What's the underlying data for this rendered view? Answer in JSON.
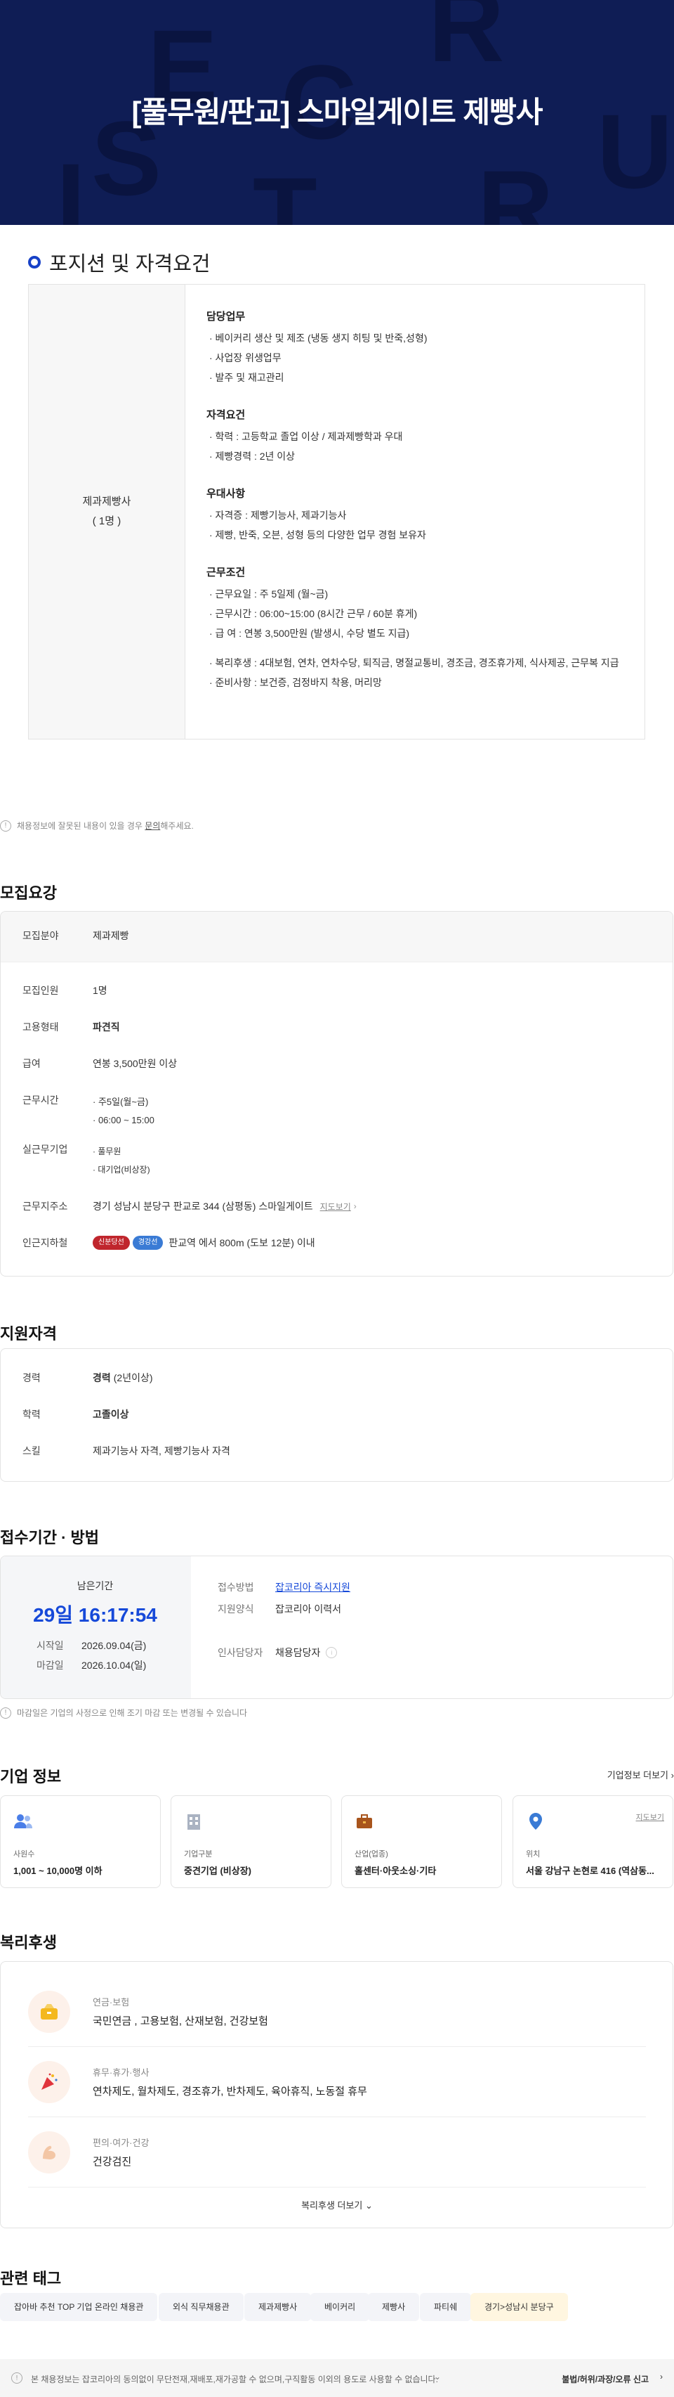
{
  "hero": {
    "title": "[풀무원/판교] 스마일게이트 제빵사",
    "letters": [
      "E",
      "R",
      "C",
      "S",
      "U",
      "I",
      "R",
      "T"
    ]
  },
  "position": {
    "heading": "포지션 및 자격요건",
    "job_name": "제과제빵사",
    "headcount": "( 1명 )",
    "groups": [
      {
        "title": "담당업무",
        "items": [
          "· 베이커리 생산 및 제조 (냉동 생지 히팅 및 반죽,성형)",
          "· 사업장 위생업무",
          "· 발주 및 재고관리"
        ]
      },
      {
        "title": "자격요건",
        "items": [
          "· 학력 : 고등학교 졸업 이상 / 제과제빵학과 우대",
          "· 제빵경력 : 2년 이상"
        ]
      },
      {
        "title": "우대사항",
        "items": [
          "· 자격증 : 제빵기능사, 제과기능사",
          "· 제빵, 반죽, 오븐, 성형 등의 다양한 업무 경험 보유자"
        ]
      },
      {
        "title": "근무조건",
        "items": [
          "· 근무요일 : 주 5일제 (월~금)",
          "· 근무시간 : 06:00~15:00 (8시간 근무 / 60분 휴게)",
          "· 급      여 : 연봉 3,500만원 (발생시, 수당 별도 지급)",
          "",
          "· 복리후생 : 4대보험, 연차, 연차수당, 퇴직금, 명절교통비, 경조금, 경조휴가제, 식사제공, 근무복 지급",
          "· 준비사항 : 보건증, 검정바지 착용, 머리망"
        ]
      }
    ]
  },
  "notice": {
    "text": "채용정보에 잘못된 내용이 있을 경우",
    "link": "문의",
    "tail": "해주세요."
  },
  "recruit": {
    "heading": "모집요강",
    "field_label": "모집분야",
    "field_value": "제과제빵",
    "headcount_label": "모집인원",
    "headcount_value": "1명",
    "type_label": "고용형태",
    "type_value": "파견직",
    "salary_label": "급여",
    "salary_value": "연봉 3,500만원 이상",
    "hours_label": "근무시간",
    "hours_values": [
      "주5일(월~금)",
      "06:00 ~ 15:00"
    ],
    "company_label": "실근무기업",
    "company_values": [
      "풀무원",
      "대기업(비상장)"
    ],
    "address_label": "근무지주소",
    "address_value": "경기 성남시 분당구 판교로 344 (삼평동) 스마일게이트",
    "address_link": "지도보기",
    "subway_label": "인근지하철",
    "subway_lines": [
      "신분당선",
      "경강선"
    ],
    "subway_value": "판교역 에서 800m (도보 12분) 이내"
  },
  "qualify": {
    "heading": "지원자격",
    "career_label": "경력",
    "career_value": "경력",
    "career_sub": "(2년이상)",
    "edu_label": "학력",
    "edu_value": "고졸이상",
    "skill_label": "스킬",
    "skill_value": "제과기능사 자격, 제빵기능사 자격"
  },
  "apply": {
    "heading": "접수기간 · 방법",
    "remain_label": "남은기간",
    "remain_value": "29일 16:17:54",
    "start_label": "시작일",
    "start_value": "2026.09.04(금)",
    "end_label": "마감일",
    "end_value": "2026.10.04(일)",
    "method_label": "접수방법",
    "method_value": "잡코리아 즉시지원",
    "form_label": "지원양식",
    "form_value": "잡코리아 이력서",
    "hr_label": "인사담당자",
    "hr_value": "채용담당자",
    "note": "마감일은 기업의 사정으로 인해 조기 마감 또는 변경될 수 있습니다"
  },
  "corp": {
    "heading": "기업 정보",
    "more": "기업정보 더보기",
    "cards": [
      {
        "label": "사원수",
        "value": "1,001 ~ 10,000명 이하",
        "icon": "people-icon"
      },
      {
        "label": "기업구분",
        "value": "중견기업 (비상장)",
        "icon": "building-icon"
      },
      {
        "label": "산업(업종)",
        "value": "홀센터·아웃소싱·기타",
        "icon": "briefcase-icon"
      },
      {
        "label": "위치",
        "value": "서울 강남구 논현로 416 (역삼동...",
        "icon": "pin-icon",
        "link": "지도보기"
      }
    ]
  },
  "benefit": {
    "heading": "복리후생",
    "items": [
      {
        "cat": "연금·보험",
        "val": "국민연금 , 고용보험, 산재보험, 건강보험",
        "icon": "piggy-icon"
      },
      {
        "cat": "휴무·휴가·행사",
        "val": "연차제도, 월차제도, 경조휴가, 반차제도, 육아휴직, 노동절 휴무",
        "icon": "party-icon"
      },
      {
        "cat": "편의·여가·건강",
        "val": "건강검진",
        "icon": "muscle-icon"
      }
    ],
    "more": "복리후생 더보기"
  },
  "tags": {
    "heading": "관련 태그",
    "items": [
      "잡아바 추천 TOP 기업 온라인 채용관",
      "외식 직무채용관",
      "제과제빵사",
      "베이커리",
      "제빵사",
      "파티쉐",
      "경기>성남시 분당구"
    ]
  },
  "footer": {
    "text": "본 채용정보는 잡코리아의 동의없이 무단전재,재배포,재가공할 수 없으며,구직활동 이외의 용도로 사용할 수 없습니다.",
    "report": "불법/허위/과장/오류 신고"
  },
  "colors": {
    "hero_bg": "#0f1d55",
    "accent_blue": "#1649d9",
    "line_red": "#c0262d",
    "line_blue": "#3a7bd5"
  }
}
